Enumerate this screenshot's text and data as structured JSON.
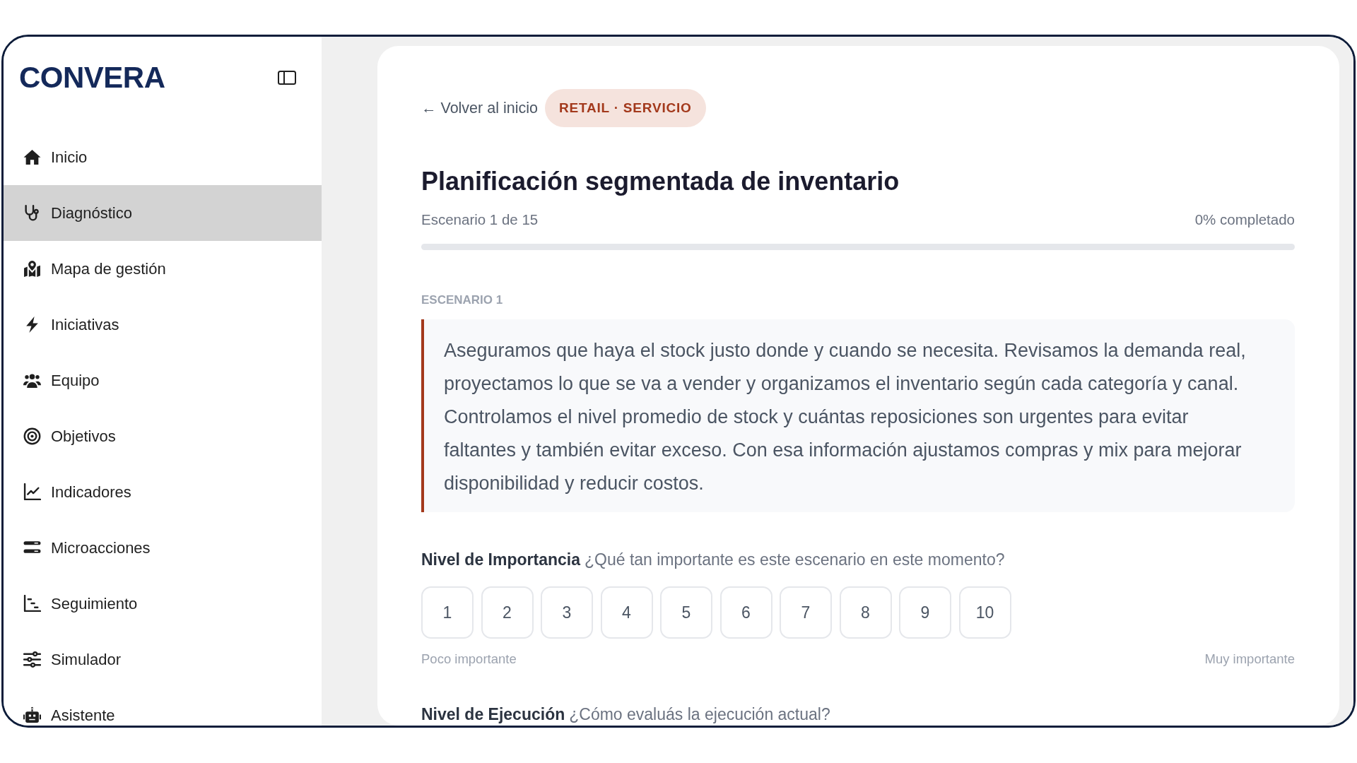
{
  "sidebar": {
    "logo": "CONVERA",
    "items": [
      {
        "label": "Inicio",
        "selected": false
      },
      {
        "label": "Diagnóstico",
        "selected": true
      },
      {
        "label": "Mapa de gestión",
        "selected": false
      },
      {
        "label": "Iniciativas",
        "selected": false
      },
      {
        "label": "Equipo",
        "selected": false
      },
      {
        "label": "Objetivos",
        "selected": false
      },
      {
        "label": "Indicadores",
        "selected": false
      },
      {
        "label": "Microacciones",
        "selected": false
      },
      {
        "label": "Seguimiento",
        "selected": false
      },
      {
        "label": "Simulador",
        "selected": false
      },
      {
        "label": "Asistente",
        "selected": false
      }
    ]
  },
  "header": {
    "back_link": "← Volver al inicio",
    "badge": "RETAIL · SERVICIO"
  },
  "title": "Planificación segmentada de inventario",
  "progress": {
    "step": "Escenario 1 de 15",
    "percent": "0% completado",
    "level": 0
  },
  "scenario": {
    "label": "ESCENARIO 1",
    "text": "Aseguramos que haya el stock justo donde y cuando se necesita. Revisamos la demanda real, proyectamos lo que se va a vender y organizamos el inventario según cada categoría y canal. Controlamos el nivel promedio de stock y cuántas reposiciones son urgentes para evitar faltantes y también evitar exceso. Con esa información ajustamos compras y mix para mejorar disponibilidad y reducir costos."
  },
  "questions": [
    {
      "title": "Nivel de Importancia",
      "prompt": "¿Qué tan importante es este escenario en este momento?",
      "options": [
        {
          "label": "1",
          "selected": false
        },
        {
          "label": "2",
          "selected": false
        },
        {
          "label": "3",
          "selected": false
        },
        {
          "label": "4",
          "selected": false
        },
        {
          "label": "5",
          "selected": false
        },
        {
          "label": "6",
          "selected": false
        },
        {
          "label": "7",
          "selected": false
        },
        {
          "label": "8",
          "selected": false
        },
        {
          "label": "9",
          "selected": false
        },
        {
          "label": "10",
          "selected": false
        }
      ],
      "min_label": "Poco importante",
      "max_label": "Muy importante"
    },
    {
      "title": "Nivel de Ejecución",
      "prompt": "¿Cómo evaluás la ejecución actual?"
    }
  ]
}
